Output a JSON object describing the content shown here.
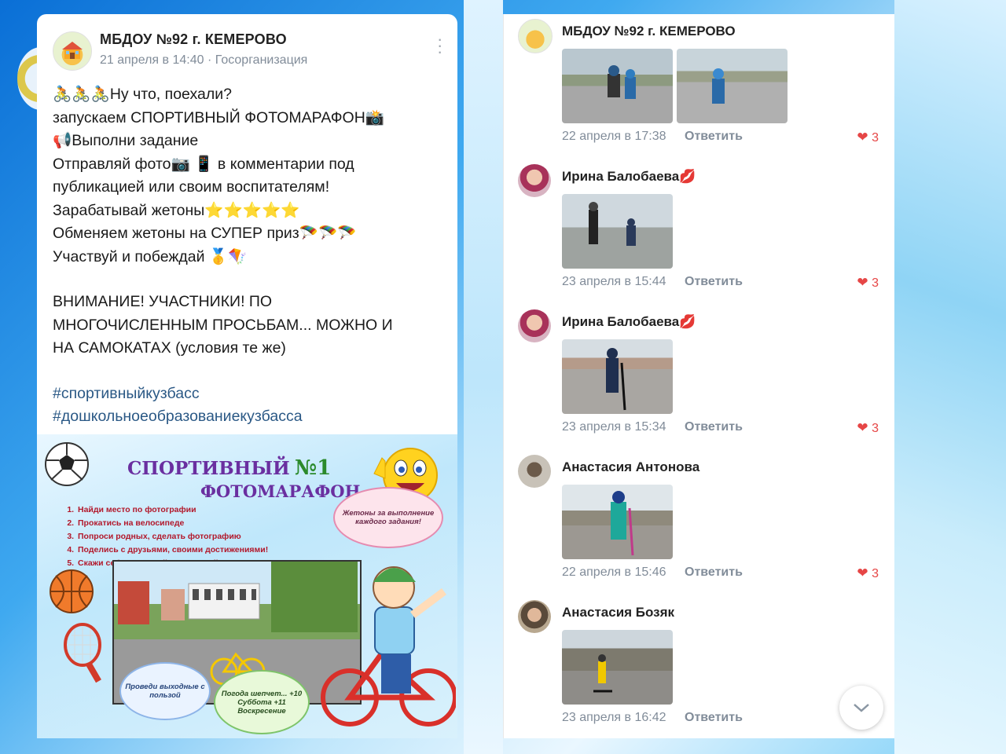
{
  "post": {
    "group_name": "МБДОУ №92 г. КЕМЕРОВО",
    "meta": "21 апреля в 14:40 · Госорганизация",
    "lines": [
      "🚴🚴🚴Ну что, поехали?",
      "запускаем СПОРТИВНЫЙ ФОТОМАРАФОН📸",
      "📢Выполни задание",
      "Отправляй фото📷 📱 в комментарии под",
      "публикацией или своим воспитателям!",
      "Зарабатывай жетоны⭐⭐⭐⭐⭐",
      "Обменяем жетоны на СУПЕР приз🪂🪂🪂",
      "Участвуй и побеждай 🥇🪁"
    ],
    "notice_lines": [
      "ВНИМАНИЕ! УЧАСТНИКИ! ПО",
      "МНОГОЧИСЛЕННЫМ ПРОСЬБАМ... МОЖНО И",
      "НА САМОКАТАХ (условия те же)"
    ],
    "hashtags": [
      "#спортивныйкузбасс",
      "#дошкольноеобразованиекузбасса"
    ]
  },
  "poster": {
    "title_line1": "СПОРТИВНЫЙ",
    "title_number": "№1",
    "title_line2": "ФОТОМАРАФОН",
    "tasks": [
      "Найди место по фотографии",
      "Прокатись на велосипеде",
      "Попроси родных, сделать фотографию",
      "Поделись с друзьями, своими достижениями!",
      "Скажи себе: #Ясамыйспортивный"
    ],
    "cloud_tokens": "Жетоны за выполнение каждого задания!",
    "cloud_weekend": "Проведи выходные с пользой",
    "cloud_weather": "Погода шепчет... +10 Суббота +11 Воскресение"
  },
  "comments": [
    {
      "name": "МБДОУ №92 г. КЕМЕРОВО",
      "date": "22 апреля в 17:38",
      "reply": "Ответить",
      "likes": "3",
      "photos": 2,
      "avatar": "group-avatar"
    },
    {
      "name": "Ирина Балобаева💋",
      "date": "23 апреля в 15:44",
      "reply": "Ответить",
      "likes": "3",
      "photos": 1,
      "avatar": "user-avatar"
    },
    {
      "name": "Ирина Балобаева💋",
      "date": "23 апреля в 15:34",
      "reply": "Ответить",
      "likes": "3",
      "photos": 1,
      "avatar": "user-avatar"
    },
    {
      "name": "Анастасия Антонова",
      "date": "22 апреля в 15:46",
      "reply": "Ответить",
      "likes": "3",
      "photos": 1,
      "avatar": "user-avatar"
    },
    {
      "name": "Анастасия Бозяк",
      "date": "23 апреля в 16:42",
      "reply": "Ответить",
      "likes": "",
      "photos": 1,
      "avatar": "user-avatar"
    }
  ],
  "colors": {
    "like": "#e64646",
    "meta": "#818c99",
    "hashtag": "#2a5885",
    "poster_title": "#6a2fa0"
  },
  "icons": {
    "more": "more-vertical-icon",
    "heart": "heart-icon",
    "scroll": "chevron-down-icon"
  }
}
